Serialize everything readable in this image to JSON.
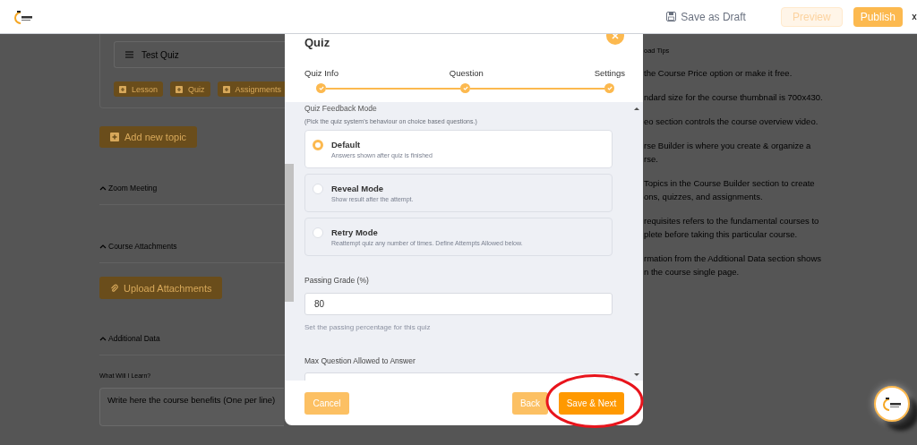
{
  "header": {
    "save_draft": "Save as Draft",
    "preview": "Preview",
    "publish": "Publish"
  },
  "builder": {
    "topic_item": "Test Quiz",
    "add_buttons": [
      "Lesson",
      "Quiz",
      "Assignments"
    ],
    "add_topic": "Add new topic",
    "sections": [
      {
        "title": "Zoom Meeting"
      },
      {
        "title": "Course Attachments",
        "upload": "Upload Attachments"
      },
      {
        "title": "Additional Data",
        "field_label": "What Will I Learn?",
        "placeholder": "Write here the course benefits (One per line)"
      }
    ]
  },
  "tips": {
    "title": "oad Tips",
    "items": [
      {
        "lines": [
          "the Course Price option or make it free."
        ]
      },
      {
        "lines": [
          "ndard size for the course thumbnail is 700x430."
        ]
      },
      {
        "lines": [
          "eo section controls the course overview video."
        ]
      },
      {
        "lines": [
          "rse Builder is where you create & organize a",
          "rse."
        ]
      },
      {
        "lines": [
          "Topics in the Course Builder section to create",
          "ons, quizzes, and assignments."
        ]
      },
      {
        "lines": [
          "requisites refers to the fundamental courses to",
          "plete before taking this particular course."
        ]
      },
      {
        "lines": [
          "rmation from the Additional Data section shows",
          "n the course single page."
        ]
      }
    ]
  },
  "modal": {
    "title": "Quiz",
    "steps": [
      {
        "label": "Quiz Info",
        "done": true
      },
      {
        "label": "Question",
        "done": true
      },
      {
        "label": "Settings",
        "done": true
      }
    ],
    "feedback": {
      "label": "Quiz Feedback Mode",
      "hint": "(Pick the quiz system's behaviour on choice based questions.)",
      "options": [
        {
          "title": "Default",
          "description": "Answers shown after quiz is finished",
          "selected": true
        },
        {
          "title": "Reveal Mode",
          "description": "Show result after the attempt.",
          "selected": false
        },
        {
          "title": "Retry Mode",
          "description": "Reattempt quiz any number of times. Define Attempts Allowed below.",
          "selected": false
        }
      ]
    },
    "passing_grade": {
      "label": "Passing Grade (%)",
      "value": "80",
      "help": "Set the passing percentage for this quiz"
    },
    "max_question": {
      "label": "Max Question Allowed to Answer"
    },
    "buttons": {
      "cancel": "Cancel",
      "back": "Back",
      "save_next": "Save & Next"
    }
  }
}
